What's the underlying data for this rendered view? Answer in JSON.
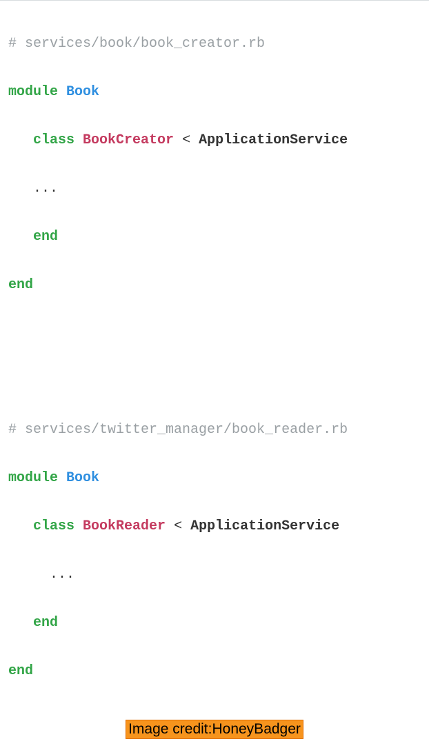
{
  "block1": {
    "comment": "# services/book/book_creator.rb",
    "kw_module": "module",
    "module_name": "Book",
    "kw_class": "class",
    "class_name": "BookCreator",
    "lt": "<",
    "parent": "ApplicationService",
    "dots": "...",
    "kw_end_inner": "end",
    "kw_end_outer": "end"
  },
  "block2": {
    "comment": "# services/twitter_manager/book_reader.rb",
    "kw_module": "module",
    "module_name": "Book",
    "kw_class": "class",
    "class_name": "BookReader",
    "lt": "<",
    "parent": "ApplicationService",
    "dots": "...",
    "kw_end_inner": "end",
    "kw_end_outer": "end"
  },
  "credit": "Image credit:HoneyBadger"
}
